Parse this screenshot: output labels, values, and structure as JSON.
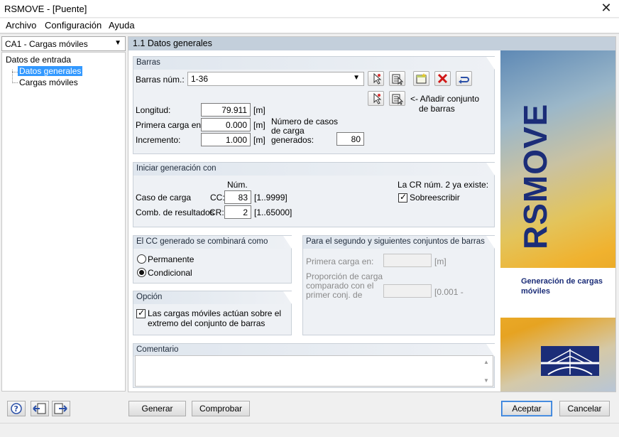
{
  "window": {
    "title": "RSMOVE - [Puente]"
  },
  "menu": [
    "Archivo",
    "Configuración",
    "Ayuda"
  ],
  "case_selector": "CA1 - Cargas móviles",
  "tree": {
    "root": "Datos de entrada",
    "items": [
      "Datos generales",
      "Cargas móviles"
    ]
  },
  "section_title": "1.1 Datos generales",
  "barras": {
    "title": "Barras",
    "num_label": "Barras núm.:",
    "num_value": "1-36",
    "add_set_label_1": "<- Añadir conjunto",
    "add_set_label_2": "de barras",
    "longitud_label": "Longitud:",
    "longitud_value": "79.911",
    "primera_label": "Primera carga en:",
    "primera_value": "0.000",
    "incremento_label": "Incremento:",
    "incremento_value": "1.000",
    "unit": "[m]",
    "num_casos_label_1": "Número de casos",
    "num_casos_label_2": "de carga",
    "num_casos_label_3": "generados:",
    "num_casos_value": "80"
  },
  "iniciar": {
    "title": "Iniciar generación con",
    "num_header": "Núm.",
    "caso_label": "Caso de carga",
    "cc_label": "CC:",
    "cc_value": "83",
    "cc_range": "[1..9999]",
    "comb_label": "Comb. de resultados",
    "cr_label": "CR:",
    "cr_value": "2",
    "cr_range": "[1..65000]",
    "cr_exists": "La CR núm. 2 ya existe:",
    "overwrite_label": "Sobreescribir",
    "overwrite_checked": true
  },
  "combinara": {
    "title": "El CC generado se combinará como",
    "options": [
      "Permanente",
      "Condicional"
    ],
    "selected": "Condicional"
  },
  "opcion": {
    "title": "Opción",
    "check_line1": "Las cargas móviles actúan sobre el",
    "check_line2": "extremo del conjunto de barras",
    "checked": true
  },
  "segundo": {
    "title": "Para el segundo y siguientes conjuntos de barras",
    "primera_label": "Primera carga en:",
    "primera_unit": "[m]",
    "prop_label_1": "Proporción de carga",
    "prop_label_2": "comparado con el",
    "prop_label_3": "primer conj. de",
    "prop_unit": "[0.001 -"
  },
  "comentario": {
    "title": "Comentario",
    "value": ""
  },
  "banner": {
    "logo": "RSMOVE",
    "subtitle": "Generación de cargas móviles"
  },
  "buttons": {
    "generar": "Generar",
    "comprobar": "Comprobar",
    "aceptar": "Aceptar",
    "cancelar": "Cancelar"
  }
}
